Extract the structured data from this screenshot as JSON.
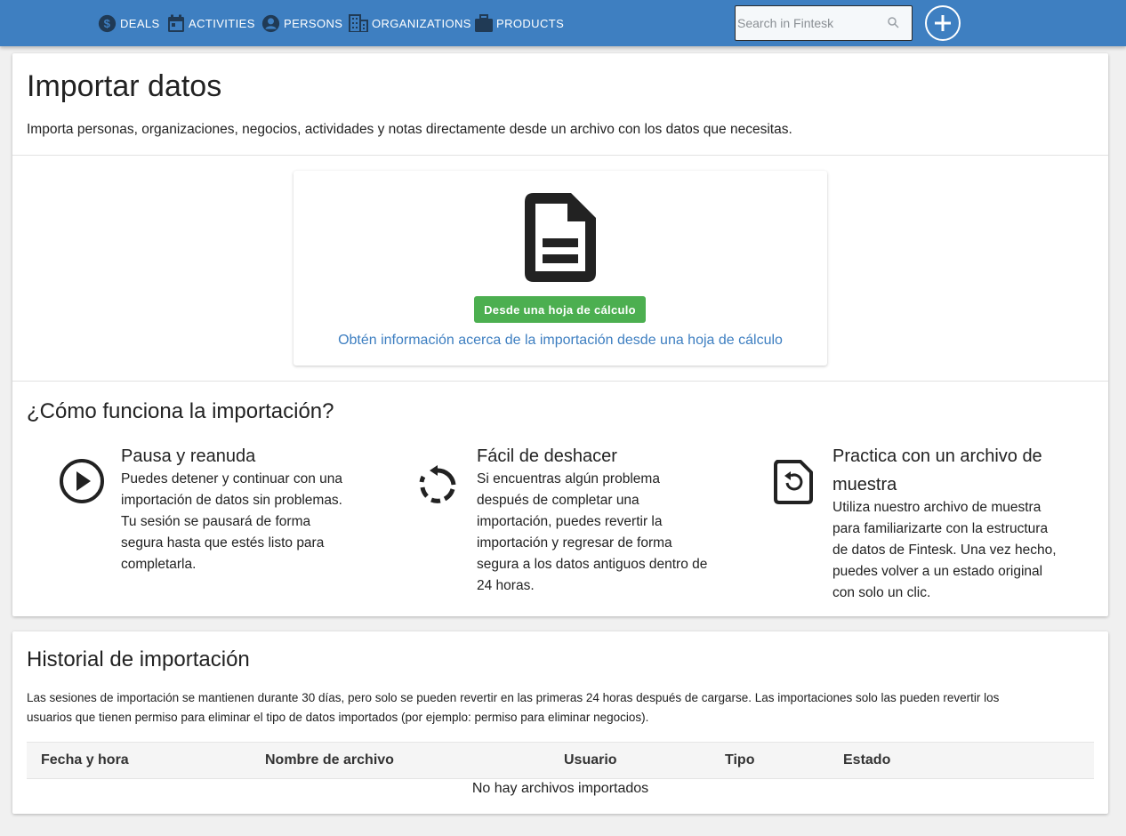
{
  "nav": {
    "items": [
      {
        "label": "DEALS",
        "icon": "dollar-icon"
      },
      {
        "label": "ACTIVITIES",
        "icon": "calendar-icon"
      },
      {
        "label": "PERSONS",
        "icon": "person-icon"
      },
      {
        "label": "ORGANIZATIONS",
        "icon": "building-icon"
      },
      {
        "label": "PRODUCTS",
        "icon": "briefcase-icon"
      }
    ],
    "search_placeholder": "Search in Fintesk",
    "add_icon": "plus-circle-icon"
  },
  "colors": {
    "topbar": "#3e7fc1",
    "primary_button": "#4caf50",
    "link": "#3e7fc1",
    "background": "#f0f0f0"
  },
  "import": {
    "title": "Importar datos",
    "description": "Importa personas, organizaciones, negocios, actividades y notas directamente desde un archivo con los datos que necesitas.",
    "file_icon": "spreadsheet-file-icon",
    "button_label": "Desde una hoja de cálculo",
    "info_link": "Obtén información acerca de la importación desde una hoja de cálculo"
  },
  "how": {
    "title": "¿Cómo funciona la importación?",
    "features": [
      {
        "icon": "play-circle-icon",
        "title": "Pausa y reanuda",
        "lines": [
          "Puedes detener y continuar con una",
          "importación de datos sin problemas.",
          "Tu sesión se pausará de forma",
          "segura hasta que estés listo para",
          "completarla."
        ]
      },
      {
        "icon": "undo-icon",
        "title": "Fácil de deshacer",
        "lines": [
          "Si encuentras algún problema",
          "después de completar una",
          "importación, puedes revertir la",
          "importación y regresar de forma",
          "segura a los datos antiguos dentro de",
          "24 horas."
        ]
      },
      {
        "icon": "sample-file-reset-icon",
        "title_lines": [
          "Practica con un archivo de",
          "muestra"
        ],
        "lines": [
          "Utiliza nuestro archivo de muestra",
          "para familiarizarte con la estructura",
          "de datos de Fintesk. Una vez hecho,",
          "puedes volver a un estado original",
          "con solo un clic."
        ]
      }
    ]
  },
  "history": {
    "title": "Historial de importación",
    "description_lines": [
      "Las sesiones de importación se mantienen durante 30 días, pero solo se pueden revertir en las primeras 24 horas después de cargarse. Las importaciones solo las pueden revertir los",
      "usuarios que tienen permiso para eliminar el tipo de datos importados (por ejemplo: permiso para eliminar negocios)."
    ],
    "columns": [
      "Fecha y hora",
      "Nombre de archivo",
      "Usuario",
      "Tipo",
      "Estado"
    ],
    "empty_text": "No hay archivos importados"
  }
}
